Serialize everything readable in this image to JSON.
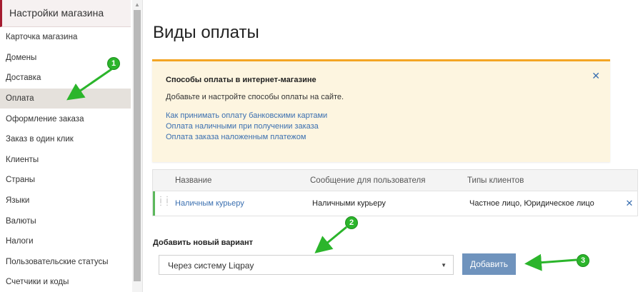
{
  "sidebar": {
    "header": "Настройки магазина",
    "items": [
      {
        "label": "Карточка магазина"
      },
      {
        "label": "Домены"
      },
      {
        "label": "Доставка"
      },
      {
        "label": "Оплата",
        "active": true
      },
      {
        "label": "Оформление заказа"
      },
      {
        "label": "Заказ в один клик"
      },
      {
        "label": "Клиенты"
      },
      {
        "label": "Страны"
      },
      {
        "label": "Языки"
      },
      {
        "label": "Валюты"
      },
      {
        "label": "Налоги"
      },
      {
        "label": "Пользовательские статусы"
      },
      {
        "label": "Счетчики и коды"
      }
    ]
  },
  "main": {
    "title": "Виды оплаты",
    "notice": {
      "title": "Способы оплаты в интернет-магазине",
      "text": "Добавьте и настройте способы оплаты на сайте.",
      "links": [
        "Как принимать оплату банковскими картами",
        "Оплата наличными при получении заказа",
        "Оплата заказа наложенным платежом"
      ],
      "close_icon": "close-icon",
      "accent_color": "#f4a524",
      "background_color": "#fdf5e0"
    },
    "table": {
      "columns": [
        "Название",
        "Сообщение для пользователя",
        "Типы клиентов"
      ],
      "rows": [
        {
          "name": "Наличным курьеру",
          "message": "Наличными курьеру",
          "types": "Частное лицо, Юридическое лицо"
        }
      ]
    },
    "add_new": {
      "label": "Добавить новый вариант",
      "selected": "Через систему Liqpay",
      "button": "Добавить"
    }
  },
  "annotations": {
    "badges": [
      "1",
      "2",
      "3"
    ],
    "color": "#2bb52b"
  }
}
